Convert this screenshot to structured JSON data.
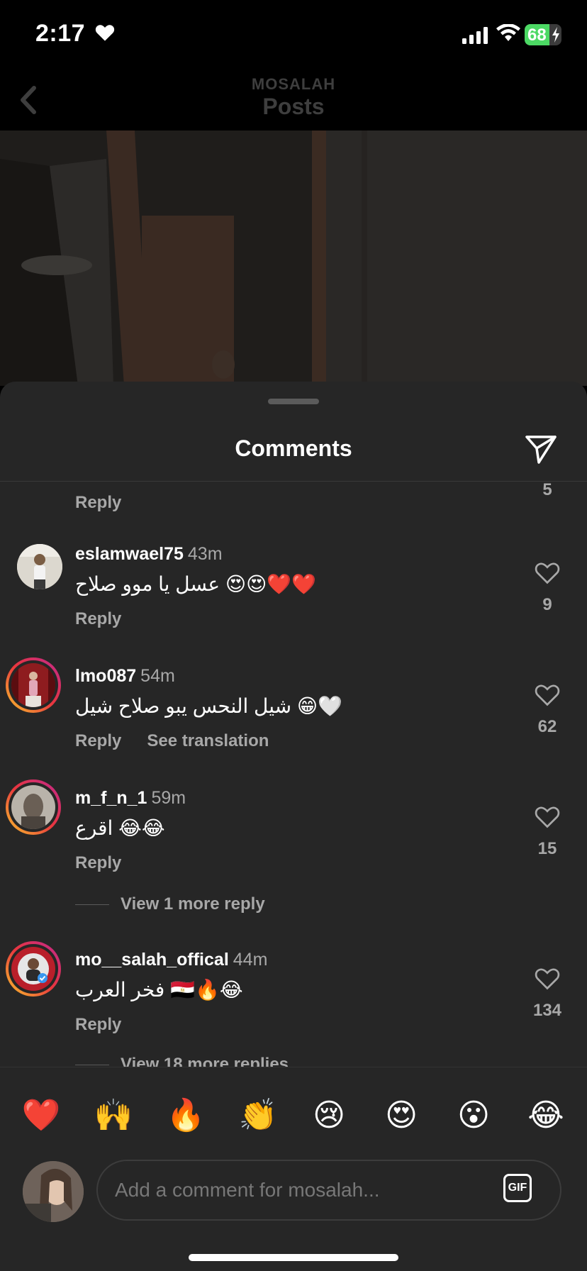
{
  "status_bar": {
    "time": "2:17",
    "battery": "68"
  },
  "header": {
    "subtitle": "MOSALAH",
    "title": "Posts"
  },
  "sheet": {
    "title": "Comments"
  },
  "partial": {
    "reply": "Reply",
    "count": "5"
  },
  "comments": [
    {
      "username": "eslamwael75",
      "ago": "43m",
      "text": "عسل يا موو صلاح 😍😍❤️❤️",
      "reply": "Reply",
      "likes": "9"
    },
    {
      "username": "lmo087",
      "ago": "54m",
      "text": "شيل النحس يبو صلاح شيل 😁🤍",
      "reply": "Reply",
      "translate": "See translation",
      "likes": "62"
    },
    {
      "username": "m_f_n_1",
      "ago": "59m",
      "text": "اقرع 😂😂",
      "reply": "Reply",
      "likes": "15",
      "more": "View 1 more reply"
    },
    {
      "username": "mo__salah_offical",
      "ago": "44m",
      "text": "فخر العرب 🇪🇬🔥😂",
      "reply": "Reply",
      "likes": "134",
      "more": "View 18 more replies"
    }
  ],
  "emojis": [
    "❤️",
    "🙌",
    "🔥",
    "👏",
    "😢",
    "😍",
    "😮",
    "😂"
  ],
  "composer": {
    "placeholder": "Add a comment for mosalah...",
    "gif": "GIF"
  }
}
